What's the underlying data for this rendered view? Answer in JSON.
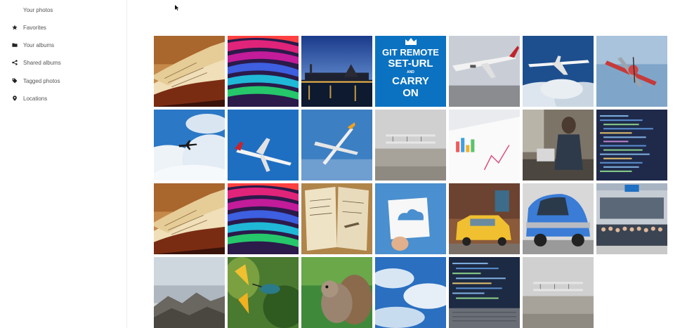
{
  "sidebar": {
    "items": [
      {
        "label": "Your photos",
        "icon": "image-icon"
      },
      {
        "label": "Favorites",
        "icon": "star-icon"
      },
      {
        "label": "Your albums",
        "icon": "folder-icon"
      },
      {
        "label": "Shared albums",
        "icon": "share-icon"
      },
      {
        "label": "Tagged photos",
        "icon": "tag-icon"
      },
      {
        "label": "Locations",
        "icon": "location-pin-icon"
      }
    ]
  },
  "poster": {
    "line1": "GIT REMOTE",
    "line2": "SET-URL",
    "line3": "AND",
    "line4": "CARRY",
    "line5": "ON"
  },
  "photos": [
    "open-book",
    "colorful-streaks",
    "harbor-night",
    "git-poster",
    "airplane-side",
    "airplane-clouds",
    "propeller-plane",
    "plane-sky-clouds",
    "airliner-blue-sky",
    "plane-blue-sky",
    "biplane-beach",
    "charts-paper",
    "man-robot",
    "code-screen",
    "open-book",
    "colorful-streaks",
    "notebook-sketches",
    "paper-cloud",
    "yellow-car",
    "smart-car",
    "group-photo",
    "rocky-beach",
    "hummingbird",
    "squirrel",
    "cloudy-sky",
    "code-laptop",
    "biplane-beach"
  ],
  "colors": {
    "sidebar_border": "#ededed",
    "poster_blue": "#0b72c1"
  }
}
